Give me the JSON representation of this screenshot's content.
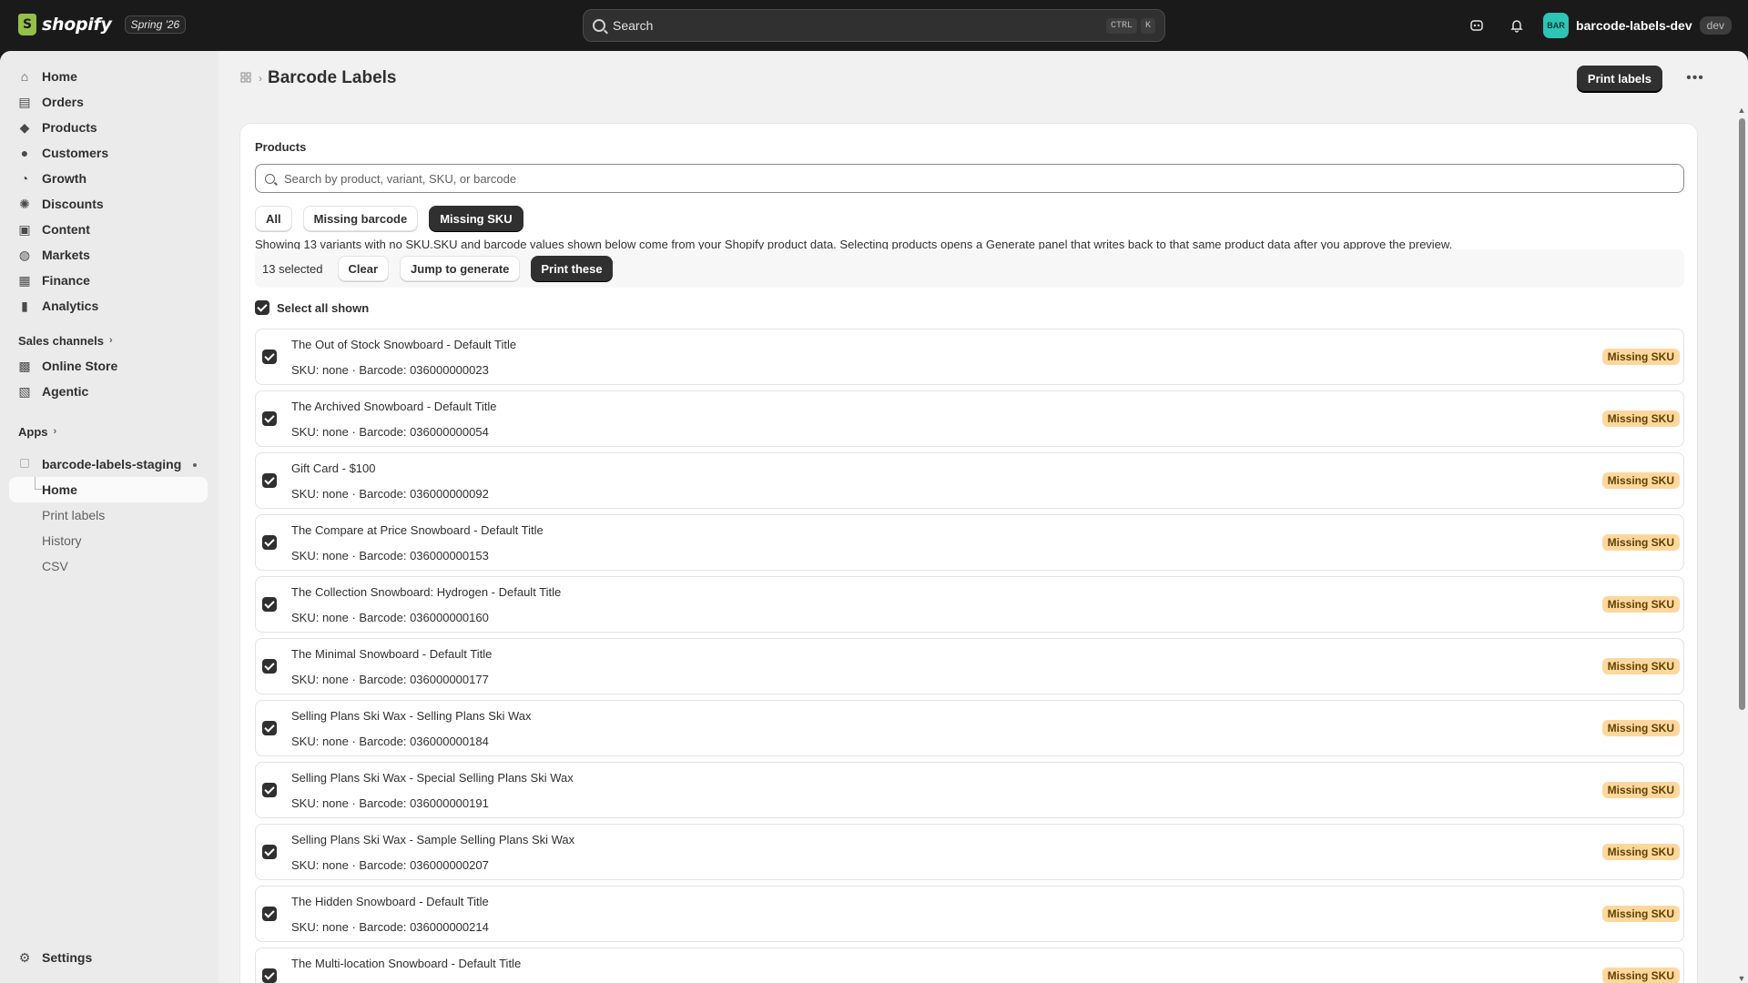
{
  "topbar": {
    "brand": "shopify",
    "edition_badge": "Spring '26",
    "search_placeholder": "Search",
    "shortcut_keys": [
      "CTRL",
      "K"
    ],
    "avatar_initials": "BAR",
    "store_name": "barcode-labels-dev",
    "env_badge": "dev"
  },
  "sidebar": {
    "items": [
      {
        "label": "Home",
        "icon": "home-icon",
        "glyph": "⌂"
      },
      {
        "label": "Orders",
        "icon": "orders-icon",
        "glyph": "▤"
      },
      {
        "label": "Products",
        "icon": "tag-icon",
        "glyph": "◆"
      },
      {
        "label": "Customers",
        "icon": "person-icon",
        "glyph": "●"
      },
      {
        "label": "Growth",
        "icon": "growth-icon",
        "glyph": "◔"
      },
      {
        "label": "Discounts",
        "icon": "discount-icon",
        "glyph": "✺"
      },
      {
        "label": "Content",
        "icon": "content-icon",
        "glyph": "▣"
      },
      {
        "label": "Markets",
        "icon": "globe-icon",
        "glyph": "◍"
      },
      {
        "label": "Finance",
        "icon": "bank-icon",
        "glyph": "▦"
      },
      {
        "label": "Analytics",
        "icon": "bar-chart-icon",
        "glyph": "▮"
      }
    ],
    "sales_channels_label": "Sales channels",
    "channels": [
      {
        "label": "Online Store",
        "icon": "store-icon",
        "glyph": "▩"
      },
      {
        "label": "Agentic",
        "icon": "agent-icon",
        "glyph": "▧"
      }
    ],
    "apps_label": "Apps",
    "app": {
      "name": "barcode-labels-staging",
      "sub_items": [
        "Home",
        "Print labels",
        "History",
        "CSV"
      ]
    },
    "settings_label": "Settings"
  },
  "header": {
    "title": "Barcode Labels",
    "primary_action": "Print labels"
  },
  "card": {
    "title": "Products",
    "search_placeholder": "Search by product, variant, SKU, or barcode",
    "filters": [
      "All",
      "Missing barcode",
      "Missing SKU"
    ],
    "active_filter": "Missing SKU",
    "info_text": "Showing 13 variants with no SKU.SKU and barcode values shown below come from your Shopify product data. Selecting products opens a Generate panel that writes back to that same product data after you approve the preview.",
    "selection": {
      "count_label": "13 selected",
      "clear": "Clear",
      "jump": "Jump to generate",
      "print": "Print these"
    },
    "select_all_label": "Select all shown",
    "badge_label": "Missing SKU",
    "rows": [
      {
        "title": "The Out of Stock Snowboard - Default Title",
        "sub": "SKU: none · Barcode: 036000000023"
      },
      {
        "title": "The Archived Snowboard - Default Title",
        "sub": "SKU: none · Barcode: 036000000054"
      },
      {
        "title": "Gift Card - $100",
        "sub": "SKU: none · Barcode: 036000000092"
      },
      {
        "title": "The Compare at Price Snowboard - Default Title",
        "sub": "SKU: none · Barcode: 036000000153"
      },
      {
        "title": "The Collection Snowboard: Hydrogen - Default Title",
        "sub": "SKU: none · Barcode: 036000000160"
      },
      {
        "title": "The Minimal Snowboard - Default Title",
        "sub": "SKU: none · Barcode: 036000000177"
      },
      {
        "title": "Selling Plans Ski Wax - Selling Plans Ski Wax",
        "sub": "SKU: none · Barcode: 036000000184"
      },
      {
        "title": "Selling Plans Ski Wax - Special Selling Plans Ski Wax",
        "sub": "SKU: none · Barcode: 036000000191"
      },
      {
        "title": "Selling Plans Ski Wax - Sample Selling Plans Ski Wax",
        "sub": "SKU: none · Barcode: 036000000207"
      },
      {
        "title": "The Hidden Snowboard - Default Title",
        "sub": "SKU: none · Barcode: 036000000214"
      },
      {
        "title": "The Multi-location Snowboard - Default Title",
        "sub": ""
      }
    ]
  },
  "colors": {
    "topbar_bg": "#1a1a1a",
    "primary_btn": "#303030",
    "badge_bg": "#ffd79d",
    "badge_text": "#5e4200",
    "avatar_bg": "#2ec4b6"
  }
}
